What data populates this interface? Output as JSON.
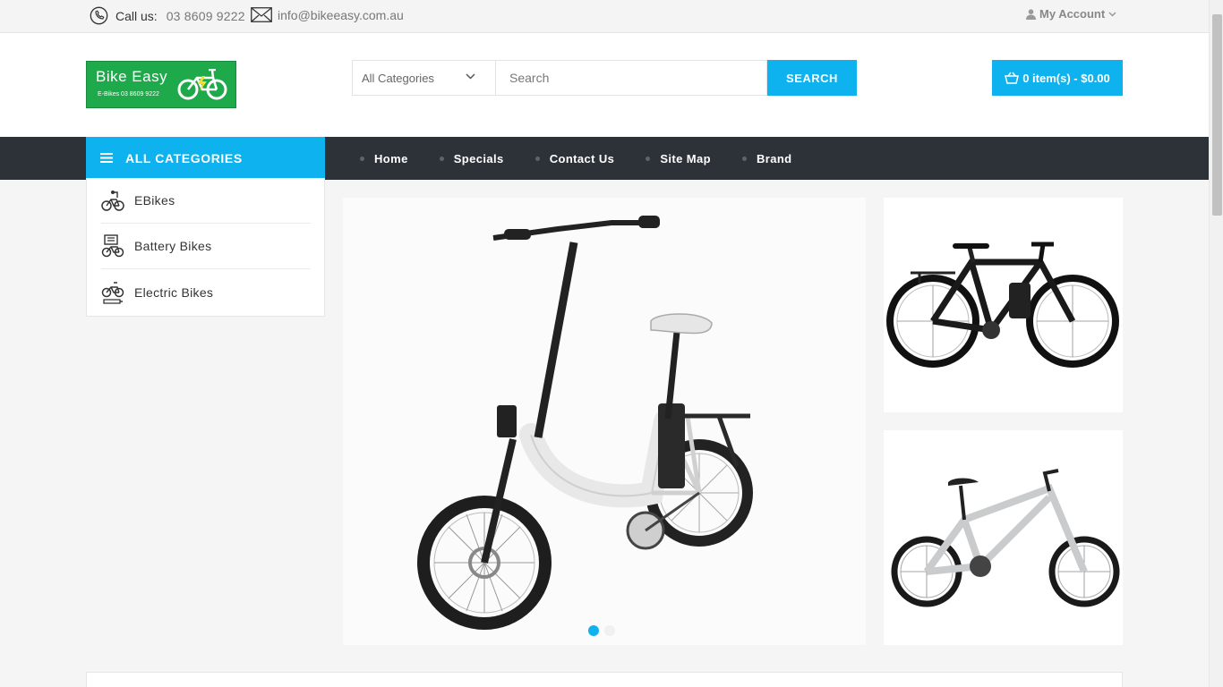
{
  "topbar": {
    "call_label": "Call us:",
    "phone": "03 8609 9222",
    "email": "info@bikeeasy.com.au",
    "account": "My Account"
  },
  "logo": {
    "title": "Bike Easy",
    "subtitle": "E-Bikes 03 8609 9222"
  },
  "search": {
    "category": "All Categories",
    "placeholder": "Search",
    "button": "SEARCH"
  },
  "cart": {
    "label": "0 item(s) - $0.00"
  },
  "nav": {
    "all_categories": "ALL CATEGORIES",
    "items": [
      "Home",
      "Specials",
      "Contact Us",
      "Site Map",
      "Brand"
    ]
  },
  "sidebar": {
    "items": [
      {
        "label": "EBikes",
        "icon": "ebike-icon"
      },
      {
        "label": "Battery Bikes",
        "icon": "battery-bike-icon"
      },
      {
        "label": "Electric Bikes",
        "icon": "electric-bike-icon"
      }
    ]
  },
  "slider": {
    "slide_count": 2,
    "active_slide": 1
  },
  "colors": {
    "accent": "#0db2ee",
    "nav_bg": "#2d3239",
    "logo_bg": "#1ea94a"
  }
}
